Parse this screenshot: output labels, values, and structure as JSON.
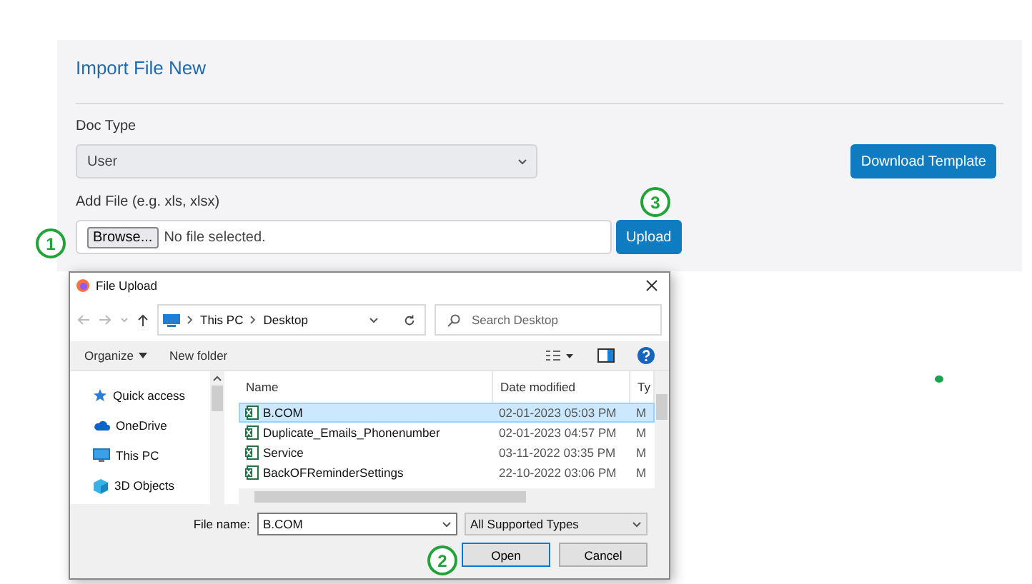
{
  "panel": {
    "title": "Import File New",
    "doc_type": {
      "label": "Doc Type",
      "value": "User"
    },
    "download_button": "Download Template",
    "add_file": {
      "label": "Add File (e.g. xls, xlsx)",
      "browse": "Browse...",
      "status": "No file selected."
    },
    "upload_button": "Upload"
  },
  "annotations": [
    {
      "label": "1",
      "kind": "browse"
    },
    {
      "label": "3",
      "kind": "upload"
    },
    {
      "label": "2",
      "kind": "open"
    }
  ],
  "dialog": {
    "title": "File Upload",
    "path": [
      "This PC",
      "Desktop"
    ],
    "search_placeholder": "Search Desktop",
    "organize": "Organize",
    "new_folder": "New folder",
    "nav_items": [
      {
        "label": "Quick access",
        "kind": "star"
      },
      {
        "label": "OneDrive",
        "kind": "cloud"
      },
      {
        "label": "This PC",
        "kind": "pc"
      },
      {
        "label": "3D Objects",
        "kind": "cube"
      }
    ],
    "columns": [
      "Name",
      "Date modified",
      "Ty"
    ],
    "files": [
      {
        "name": "B.COM",
        "date": "02-01-2023 05:03 PM",
        "type": "M",
        "selected": true
      },
      {
        "name": "Duplicate_Emails_Phonenumber",
        "date": "02-01-2023 04:57 PM",
        "type": "M",
        "selected": false
      },
      {
        "name": "Service",
        "date": "03-11-2022 03:35 PM",
        "type": "M",
        "selected": false
      },
      {
        "name": "BackOFReminderSettings",
        "date": "22-10-2022 03:06 PM",
        "type": "M",
        "selected": false
      }
    ],
    "file_name_label": "File name:",
    "file_name": "B.COM",
    "file_type": "All Supported Types",
    "open_button": "Open",
    "cancel_button": "Cancel"
  }
}
